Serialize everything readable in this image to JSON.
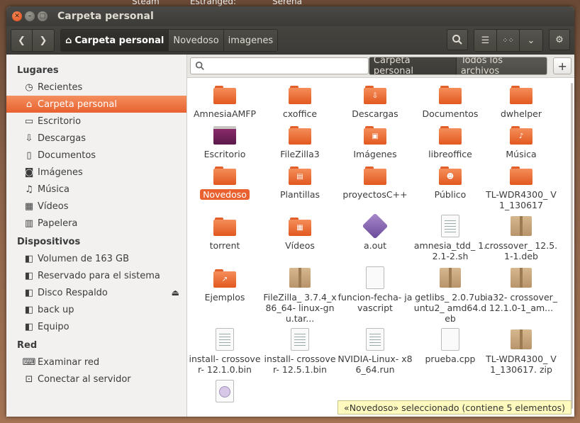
{
  "desktop": {
    "top_labels": [
      "Steam",
      "Estranged:",
      "Serena"
    ]
  },
  "window": {
    "title": "Carpeta personal"
  },
  "toolbar": {
    "breadcrumbs": [
      "Carpeta personal",
      "Novedoso",
      "imagenes"
    ]
  },
  "sidebar": {
    "sections": [
      {
        "heading": "Lugares",
        "items": [
          {
            "label": "Recientes",
            "icon": "clock-icon"
          },
          {
            "label": "Carpeta personal",
            "icon": "home-icon",
            "selected": true
          },
          {
            "label": "Escritorio",
            "icon": "desktop-icon"
          },
          {
            "label": "Descargas",
            "icon": "download-icon"
          },
          {
            "label": "Documentos",
            "icon": "document-icon"
          },
          {
            "label": "Imágenes",
            "icon": "camera-icon"
          },
          {
            "label": "Música",
            "icon": "music-icon"
          },
          {
            "label": "Vídeos",
            "icon": "film-icon"
          },
          {
            "label": "Papelera",
            "icon": "trash-icon"
          }
        ]
      },
      {
        "heading": "Dispositivos",
        "items": [
          {
            "label": "Volumen de 163 GB",
            "icon": "drive-icon"
          },
          {
            "label": "Reservado para el sistema",
            "icon": "drive-icon"
          },
          {
            "label": "Disco Respaldo",
            "icon": "drive-icon",
            "eject": true
          },
          {
            "label": "back up",
            "icon": "drive-icon"
          },
          {
            "label": "Equipo",
            "icon": "drive-icon"
          }
        ]
      },
      {
        "heading": "Red",
        "items": [
          {
            "label": "Examinar red",
            "icon": "network-icon"
          },
          {
            "label": "Conectar al servidor",
            "icon": "server-icon"
          }
        ]
      }
    ]
  },
  "search": {
    "value": "",
    "placeholder": ""
  },
  "filters": {
    "location": "Carpeta personal",
    "type": "Todos los archivos"
  },
  "files": [
    {
      "name": "AmnesiaAMFP",
      "kind": "folder"
    },
    {
      "name": "cxoffice",
      "kind": "folder"
    },
    {
      "name": "Descargas",
      "kind": "folder",
      "emblem": "download"
    },
    {
      "name": "Documentos",
      "kind": "folder"
    },
    {
      "name": "dwhelper",
      "kind": "folder"
    },
    {
      "name": "Escritorio",
      "kind": "folder-desktop"
    },
    {
      "name": "FileZilla3",
      "kind": "folder"
    },
    {
      "name": "Imágenes",
      "kind": "folder",
      "emblem": "picture"
    },
    {
      "name": "libreoffice",
      "kind": "folder"
    },
    {
      "name": "Música",
      "kind": "folder",
      "emblem": "music"
    },
    {
      "name": "Novedoso",
      "kind": "folder-selected"
    },
    {
      "name": "Plantillas",
      "kind": "folder",
      "emblem": "template"
    },
    {
      "name": "proyectosC++",
      "kind": "folder"
    },
    {
      "name": "Público",
      "kind": "folder",
      "emblem": "person"
    },
    {
      "name": "TL-WDR4300_ V1_130617",
      "kind": "folder"
    },
    {
      "name": "torrent",
      "kind": "folder"
    },
    {
      "name": "Vídeos",
      "kind": "folder",
      "emblem": "film"
    },
    {
      "name": "a.out",
      "kind": "binary"
    },
    {
      "name": "amnesia_tdd_ 1.2.1-2.sh",
      "kind": "script"
    },
    {
      "name": "crossover_ 12.5.1-1.deb",
      "kind": "package"
    },
    {
      "name": "Ejemplos",
      "kind": "folder",
      "emblem": "link"
    },
    {
      "name": "FileZilla_ 3.7.4_x86_64- linux-gnu.tar...",
      "kind": "package"
    },
    {
      "name": "funcion-fecha- javascript",
      "kind": "text"
    },
    {
      "name": "getlibs_ 2.0.7ubuntu2_ amd64.deb",
      "kind": "package"
    },
    {
      "name": "ia32- crossover_ 12.1.0-1_am...",
      "kind": "package"
    },
    {
      "name": "install- crossover- 12.1.0.bin",
      "kind": "binary-doc"
    },
    {
      "name": "install- crossover- 12.5.1.bin",
      "kind": "binary-doc"
    },
    {
      "name": "NVIDIA-Linux- x86_64.run",
      "kind": "script"
    },
    {
      "name": "prueba.cpp",
      "kind": "text"
    },
    {
      "name": "TL-WDR4300_ V1_130617. zip",
      "kind": "package"
    },
    {
      "name": "",
      "kind": "disc"
    }
  ],
  "status": {
    "text": "«Novedoso» seleccionado  (contiene 5 elementos)"
  },
  "colors": {
    "accent": "#e8612f",
    "chrome": "#3c3b37",
    "folder": "#f07a45"
  }
}
